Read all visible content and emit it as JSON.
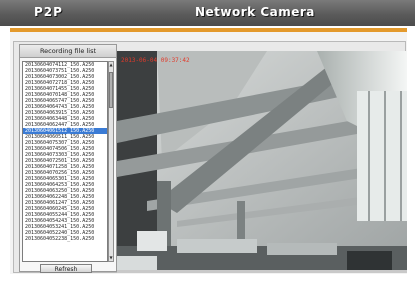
{
  "header": {
    "brand": "P2P",
    "title": "Network Camera"
  },
  "recording": {
    "panel_title": "Recording file list",
    "files": [
      "20130604074112_150.A250",
      "20130604073751_150.A250",
      "20130604073002_150.A250",
      "20130604072718_150.A250",
      "20130604071455_150.A250",
      "20130604070148_150.A250",
      "20130604065747_150.A250",
      "20130604064743_150.A250",
      "20130604063915_150.A250",
      "20130604063448_150.A250",
      "20130604062447_150.A250",
      "20130604061512_150.A250",
      "20130604060511_150.A250",
      "20130604075307_150.A250",
      "20130604074506_150.A250",
      "20130604073303_150.A250",
      "20130604072501_150.A250",
      "20130604071258_150.A250",
      "20130604070256_150.A250",
      "20130604065301_150.A250",
      "20130604064253_150.A250",
      "20130604063250_150.A250",
      "20130604062248_150.A250",
      "20130604061247_150.A250",
      "20130604060245_150.A250",
      "20130604055244_150.A250",
      "20130604054243_150.A250",
      "20130604053241_150.A250",
      "20130604052240_150.A250",
      "20130604052238_150.A250"
    ],
    "selected_index": 11,
    "refresh_label": "Refresh"
  },
  "video": {
    "timestamp": "2013-06-04 09:37:42"
  },
  "colors": {
    "accent": "#e49a2d",
    "header": "#5b5b5b",
    "selection": "#3a7bd5",
    "timestamp": "#e23a2a"
  }
}
